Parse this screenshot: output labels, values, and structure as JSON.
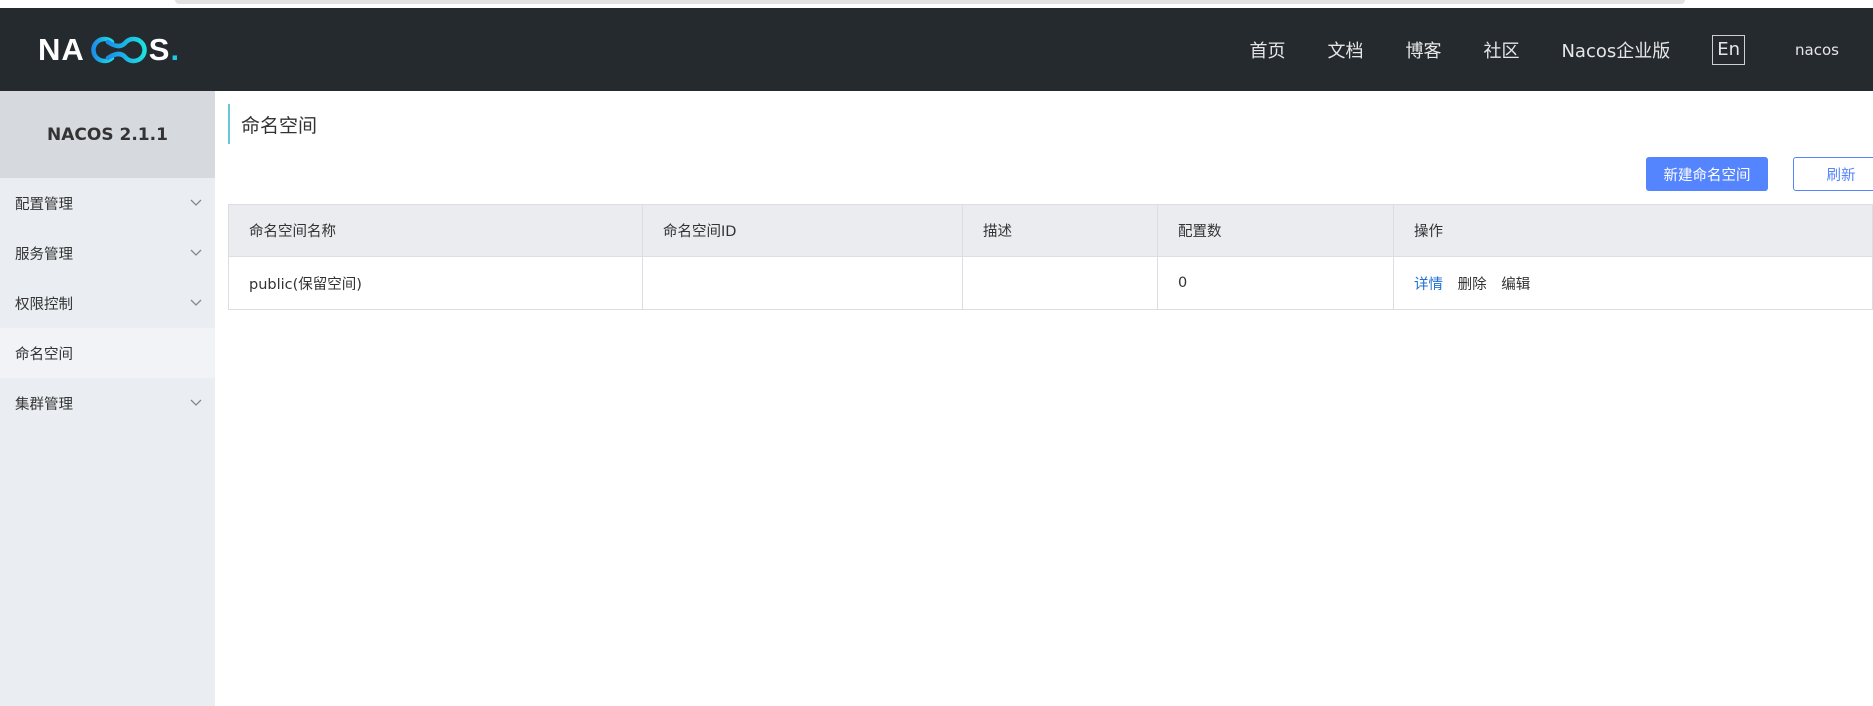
{
  "header": {
    "logo": {
      "text_left": "NA",
      "text_right": "S",
      "dot": "."
    },
    "nav": [
      "首页",
      "文档",
      "博客",
      "社区",
      "Nacos企业版"
    ],
    "lang": "En",
    "user": "nacos"
  },
  "sidebar": {
    "version": "NACOS 2.1.1",
    "items": [
      {
        "label": "配置管理",
        "expandable": true
      },
      {
        "label": "服务管理",
        "expandable": true
      },
      {
        "label": "权限控制",
        "expandable": true
      },
      {
        "label": "命名空间",
        "expandable": false,
        "active": true
      },
      {
        "label": "集群管理",
        "expandable": true
      }
    ]
  },
  "main": {
    "title": "命名空间",
    "create_button": "新建命名空间",
    "refresh_button": "刷新",
    "table": {
      "columns": [
        "命名空间名称",
        "命名空间ID",
        "描述",
        "配置数",
        "操作"
      ],
      "rows": [
        {
          "name": "public(保留空间)",
          "id": "",
          "desc": "",
          "count": "0",
          "actions": [
            "详情",
            "删除",
            "编辑"
          ]
        }
      ]
    }
  },
  "colors": {
    "header_bg": "#252a2f",
    "sidebar_bg": "#eaedf1",
    "primary": "#5584ff",
    "link": "#1f6fd6",
    "logo_accent": "#1cc7e8"
  }
}
